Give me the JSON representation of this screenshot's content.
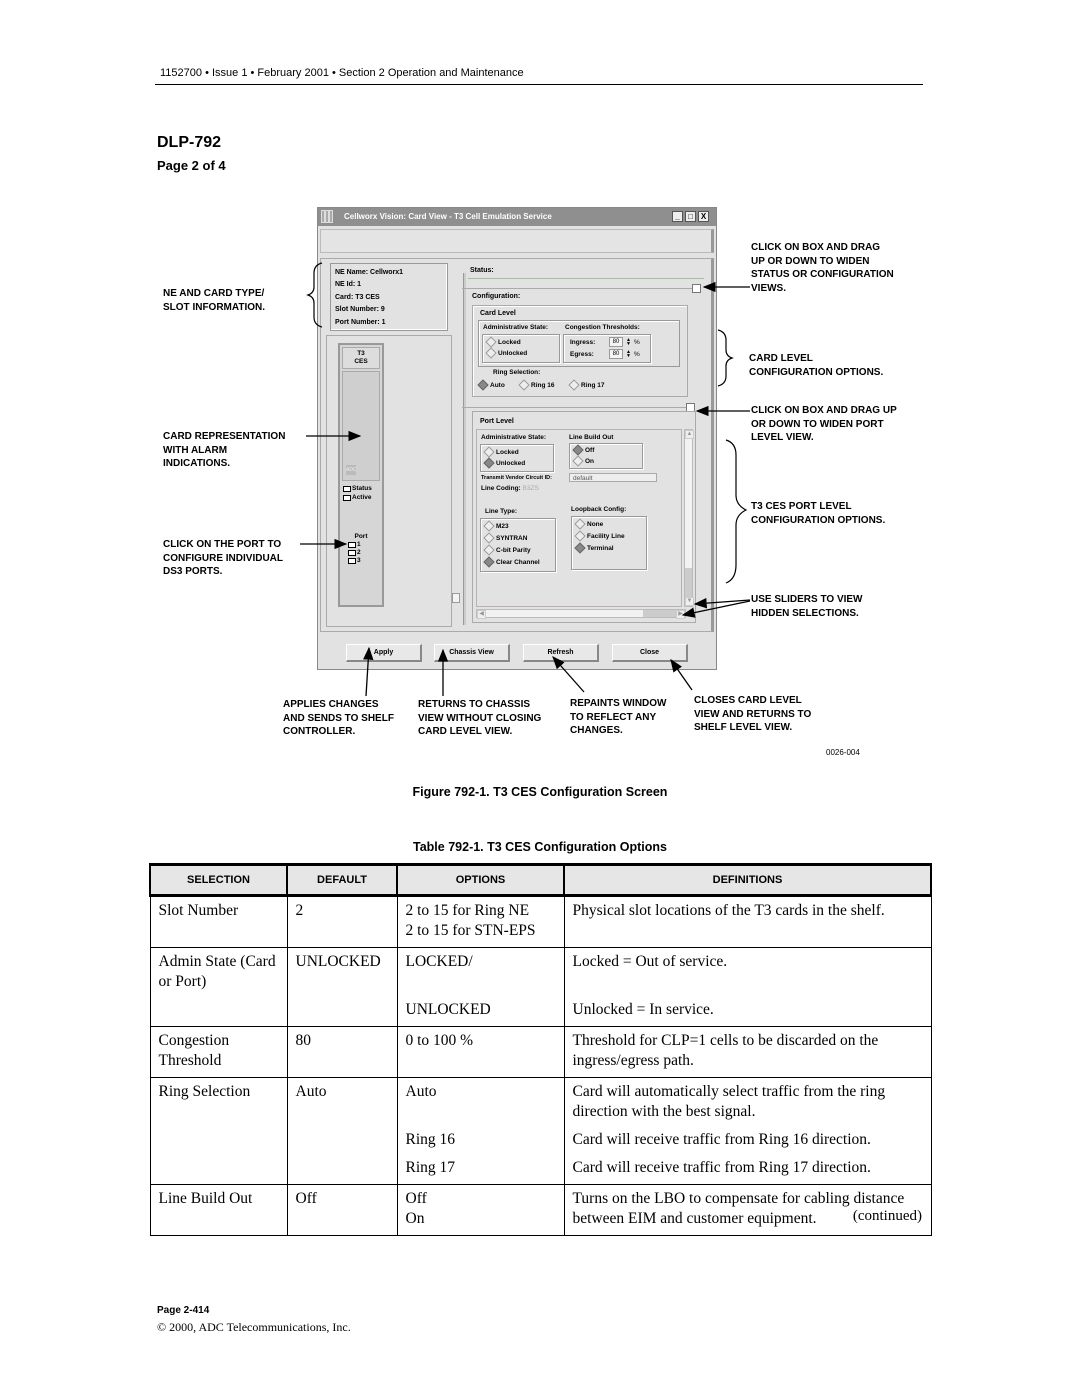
{
  "page_header": {
    "doc_line": "1152700 • Issue 1 • February 2001 • Section 2 Operation and Maintenance",
    "dlp": "DLP-792",
    "page_of": "Page 2 of 4"
  },
  "window": {
    "title": "Cellworx Vision:  Card View - T3 Cell Emulation Service",
    "title_buttons": {
      "minimize": "_",
      "maximize": "□",
      "close": "X"
    },
    "ne_info": {
      "ne_name": "NE Name: Cellworx1",
      "ne_id": "NE Id:  1",
      "card": "Card: T3 CES",
      "slot_number": "Slot Number:  9",
      "port_number": "Port Number:  1"
    },
    "card": {
      "label_line1": "T3",
      "label_line2": "CES",
      "logo": "ADC",
      "leds": [
        "Status",
        "Active"
      ],
      "port_title": "Port",
      "ports": [
        "1",
        "2",
        "3"
      ]
    },
    "status_label": "Status:",
    "configuration_label": "Configuration:",
    "card_level": {
      "title": "Card Level",
      "admin_state": {
        "title": "Administrative State:",
        "options": [
          {
            "label": "Locked",
            "selected": false
          },
          {
            "label": "Unlocked",
            "selected": false
          }
        ]
      },
      "congestion": {
        "title": "Congestion Thresholds:",
        "ingress_label": "Ingress:",
        "ingress_value": "80",
        "egress_label": "Egress:",
        "egress_value": "80",
        "unit": "%"
      },
      "ring_selection": {
        "title": "Ring Selection:",
        "options": [
          {
            "label": "Auto",
            "selected": true
          },
          {
            "label": "Ring 16",
            "selected": false
          },
          {
            "label": "Ring 17",
            "selected": false
          }
        ]
      }
    },
    "port_level": {
      "title": "Port Level",
      "admin_state": {
        "title": "Administrative State:",
        "options": [
          {
            "label": "Locked",
            "selected": false
          },
          {
            "label": "Unlocked",
            "selected": true
          }
        ]
      },
      "line_build_out": {
        "title": "Line Build Out",
        "options": [
          {
            "label": "Off",
            "selected": true
          },
          {
            "label": "On",
            "selected": false
          }
        ]
      },
      "transmit_vendor_label": "Transmit Vendor Circuit ID:",
      "transmit_vendor_value": "default",
      "line_coding_label": "Line Coding:",
      "line_coding_value": "B3ZS",
      "line_type": {
        "title": "Line Type:",
        "options": [
          {
            "label": "M23",
            "selected": false
          },
          {
            "label": "SYNTRAN",
            "selected": false
          },
          {
            "label": "C-bit Parity",
            "selected": false
          },
          {
            "label": "Clear Channel",
            "selected": true
          }
        ]
      },
      "loopback": {
        "title": "Loopback Config:",
        "options": [
          {
            "label": "None",
            "selected": false
          },
          {
            "label": "Facility Line",
            "selected": false
          },
          {
            "label": "Terminal",
            "selected": true
          }
        ]
      }
    },
    "buttons": {
      "apply": "Apply",
      "chassis_view": "Chassis View",
      "refresh": "Refresh",
      "close": "Close"
    }
  },
  "callouts": {
    "ne_card_type": [
      "NE AND CARD TYPE/",
      "SLOT INFORMATION."
    ],
    "card_representation": [
      "CARD REPRESENTATION",
      "WITH ALARM",
      "INDICATIONS."
    ],
    "click_port": [
      "CLICK ON THE PORT TO",
      "CONFIGURE INDIVIDUAL",
      "DS3 PORTS."
    ],
    "drag_status": [
      "CLICK ON BOX AND DRAG",
      "UP OR DOWN TO WIDEN",
      "STATUS OR CONFIGURATION",
      "VIEWS."
    ],
    "card_level_options": [
      "CARD LEVEL",
      "CONFIGURATION OPTIONS."
    ],
    "drag_port": [
      "CLICK ON BOX AND DRAG UP",
      "OR DOWN TO WIDEN PORT",
      "LEVEL VIEW."
    ],
    "port_level_options": [
      "T3 CES PORT LEVEL",
      "CONFIGURATION OPTIONS."
    ],
    "sliders": [
      "USE SLIDERS TO VIEW",
      "HIDDEN SELECTIONS."
    ],
    "apply": [
      "APPLIES CHANGES",
      "AND SENDS TO SHELF",
      "CONTROLLER."
    ],
    "chassis": [
      "RETURNS TO CHASSIS",
      "VIEW WITHOUT CLOSING",
      "CARD LEVEL VIEW."
    ],
    "refresh": [
      "REPAINTS WINDOW",
      "TO REFLECT ANY",
      "CHANGES."
    ],
    "close": [
      "CLOSES CARD LEVEL",
      "VIEW AND RETURNS TO",
      "SHELF LEVEL VIEW."
    ]
  },
  "figure_id": "0026-004",
  "figure_caption": "Figure 792-1. T3 CES Configuration Screen",
  "table_caption": "Table 792-1. T3 CES Configuration Options",
  "table": {
    "headers": [
      "SELECTION",
      "DEFAULT",
      "OPTIONS",
      "DEFINITIONS"
    ],
    "rows": [
      {
        "selection": "Slot Number",
        "default": "2",
        "options": "2 to 15 for Ring NE\n2 to 15 for STN-EPS",
        "definition": "Physical slot locations of the T3 cards in the shelf."
      },
      {
        "selection": "Admin State (Card or Port)",
        "default": "UNLOCKED",
        "options": "LOCKED/",
        "definition": "Locked = Out of service."
      },
      {
        "selection": "",
        "default": "",
        "options": "UNLOCKED",
        "definition": "Unlocked = In service."
      },
      {
        "selection": "Congestion Threshold",
        "default": "80",
        "options": "0 to 100 %",
        "definition": "Threshold for CLP=1 cells to be discarded on the ingress/egress path."
      },
      {
        "selection": "Ring Selection",
        "default": "Auto",
        "options": "Auto",
        "definition": "Card will automatically select traffic from the ring direction with the best signal."
      },
      {
        "selection": "",
        "default": "",
        "options": "Ring 16",
        "definition": "Card will receive traffic from Ring 16 direction."
      },
      {
        "selection": "",
        "default": "",
        "options": "Ring 17",
        "definition": "Card will receive traffic from Ring 17 direction."
      },
      {
        "selection": "Line Build Out",
        "default": "Off",
        "options": "Off\nOn",
        "definition": "Turns on the LBO to compensate for cabling distance between EIM and customer equipment."
      }
    ]
  },
  "continued": "(continued)",
  "footer": {
    "page": "Page 2-414",
    "copyright": "© 2000, ADC Telecommunications, Inc."
  }
}
